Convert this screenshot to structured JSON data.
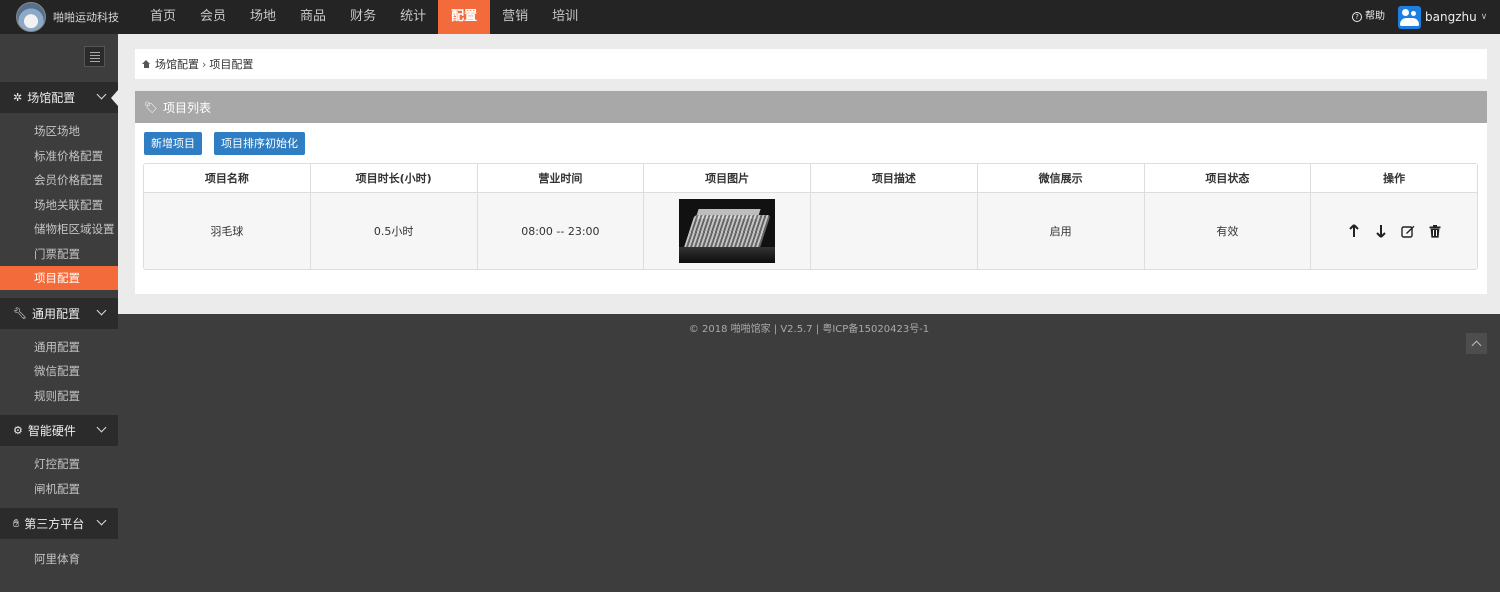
{
  "brand": {
    "name": "啪啪运动科技"
  },
  "nav": {
    "items": [
      "首页",
      "会员",
      "场地",
      "商品",
      "财务",
      "统计",
      "配置",
      "营销",
      "培训"
    ],
    "active_index": 6
  },
  "header": {
    "help_label": "帮助",
    "username": "bangzhu"
  },
  "sidebar": {
    "groups": [
      {
        "title": "场馆配置",
        "icon": "cogs-icon",
        "items": [
          "场区场地",
          "标准价格配置",
          "会员价格配置",
          "场地关联配置",
          "储物柜区域设置",
          "门票配置",
          "项目配置"
        ],
        "active_item": 6
      },
      {
        "title": "通用配置",
        "icon": "wrench-icon",
        "items": [
          "通用配置",
          "微信配置",
          "规则配置"
        ]
      },
      {
        "title": "智能硬件",
        "icon": "gear-icon",
        "items": [
          "灯控配置",
          "闸机配置"
        ]
      },
      {
        "title": "第三方平台",
        "icon": "handshake-icon",
        "items": [
          "阿里体育"
        ]
      }
    ]
  },
  "breadcrumb": {
    "parent": "场馆配置",
    "separator": "›",
    "current": "项目配置"
  },
  "panel": {
    "title": "项目列表",
    "buttons": {
      "add": "新增项目",
      "reset_order": "项目排序初始化"
    }
  },
  "table": {
    "columns": [
      "项目名称",
      "项目时长(小时)",
      "营业时间",
      "项目图片",
      "项目描述",
      "微信展示",
      "项目状态",
      "操作"
    ],
    "rows": [
      {
        "name": "羽毛球",
        "duration": "0.5小时",
        "hours": "08:00 -- 23:00",
        "description": "",
        "wechat": "启用",
        "status": "有效"
      }
    ]
  },
  "footer": {
    "text": "© 2018 啪啪馆家 | V2.5.7 | 粤ICP备15020423号-1"
  },
  "colors": {
    "accent": "#f36b3a",
    "primary_button": "#2f7dc3",
    "topbar": "#242424",
    "sidebar": "#3d3d3d"
  }
}
